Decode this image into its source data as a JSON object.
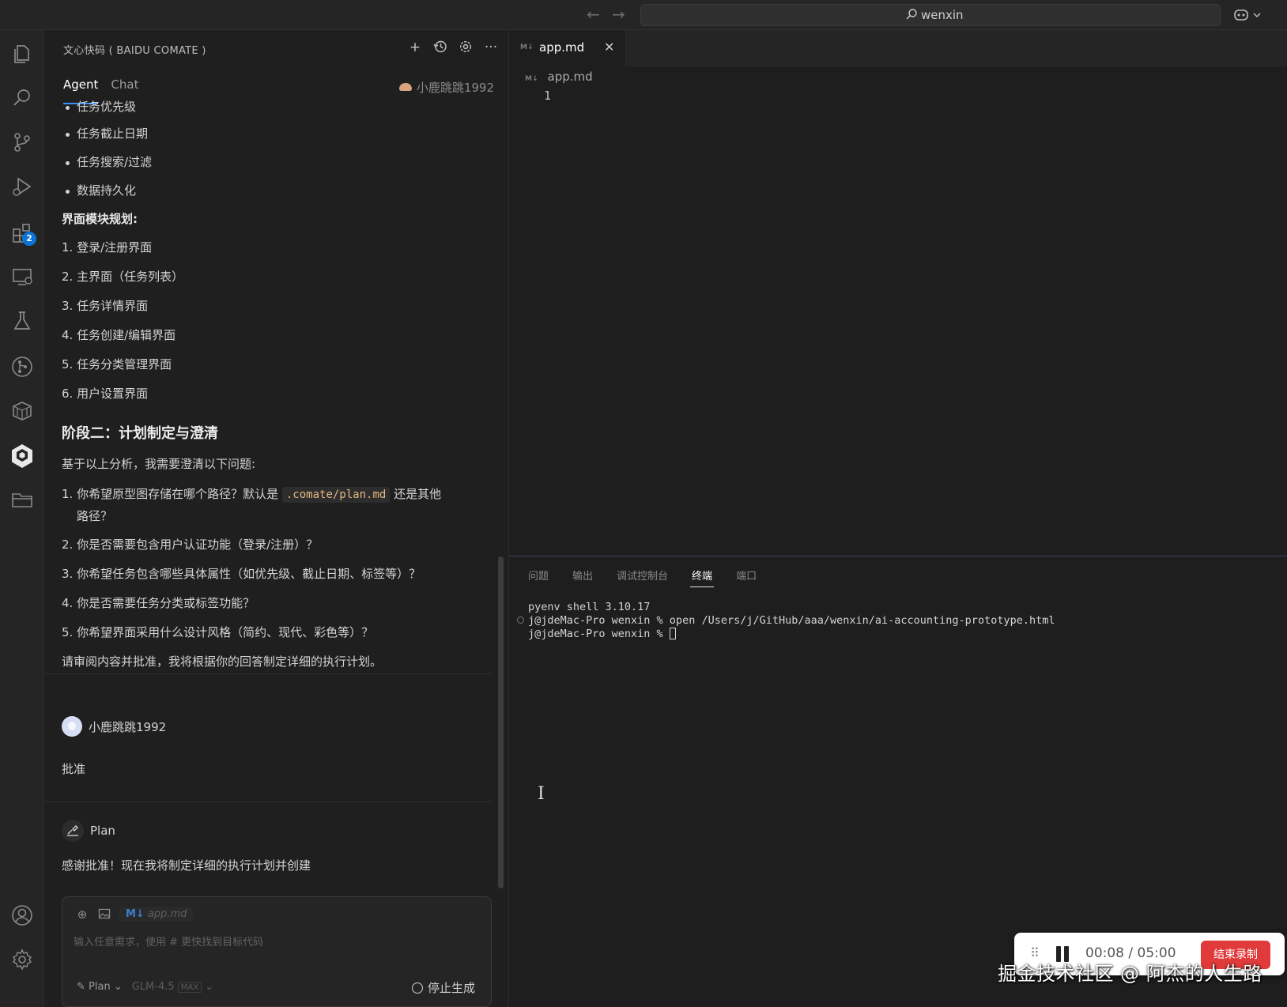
{
  "titlebar": {
    "search_text": "wenxin",
    "back": "←",
    "forward": "→"
  },
  "activity": {
    "extensions_badge": "2"
  },
  "side_panel": {
    "title": "文心快码 ( BAIDU COMATE )",
    "tabs": [
      "Agent",
      "Chat"
    ],
    "user": "小鹿跳跳1992"
  },
  "chat": {
    "bullets": [
      "任务优先级",
      "任务截止日期",
      "任务搜索/过滤",
      "数据持久化"
    ],
    "ui_heading": "界面模块规划:",
    "ui_items": [
      "1. 登录/注册界面",
      "2. 主界面（任务列表）",
      "3. 任务详情界面",
      "4. 任务创建/编辑界面",
      "5. 任务分类管理界面",
      "6. 用户设置界面"
    ],
    "section_title": "阶段二：计划制定与澄清",
    "intro": "基于以上分析，我需要澄清以下问题:",
    "q1_before": "1. 你希望原型图存储在哪个路径？默认是",
    "q1_code": ".comate/plan.md",
    "q1_after": "还是其他",
    "q1_cont": "路径？",
    "questions": [
      "2. 你是否需要包含用户认证功能（登录/注册）？",
      "3. 你希望任务包含哪些具体属性（如优先级、截止日期、标签等）？",
      "4. 你是否需要任务分类或标签功能？",
      "5. 你希望界面采用什么设计风格（简约、现代、彩色等）？"
    ],
    "closing": "请审阅内容并批准，我将根据你的回答制定详细的执行计划。",
    "user_name": "小鹿跳跳1992",
    "user_message": "批准",
    "plan_name": "Plan",
    "plan_message": "感谢批准！现在我将制定详细的执行计划并创建"
  },
  "input": {
    "file_chip_label": "M↓",
    "file_chip": "app.md",
    "placeholder": "输入任意需求，使用 # 更快找到目标代码",
    "mode": "Plan",
    "model": "GLM-4.5",
    "max": "MAX",
    "stop": "停止生成"
  },
  "editor": {
    "tab_icon": "M↓",
    "tab_name": "app.md",
    "close": "✕",
    "breadcrumb": "app.md",
    "line_number": "1"
  },
  "panel": {
    "tabs": [
      "问题",
      "输出",
      "调试控制台",
      "终端",
      "端口"
    ],
    "active_tab": "终端",
    "terminal_lines": [
      "pyenv shell 3.10.17",
      "j@jdeMac-Pro wenxin % open /Users/j/GitHub/aaa/wenxin/ai-accounting-prototype.html",
      "j@jdeMac-Pro wenxin % "
    ]
  },
  "recorder": {
    "elapsed": "00:08",
    "separator": "/",
    "total": "05:00",
    "stop_label": "结束录制"
  },
  "watermark": "掘金技术社区 @ 阿杰的人生路"
}
